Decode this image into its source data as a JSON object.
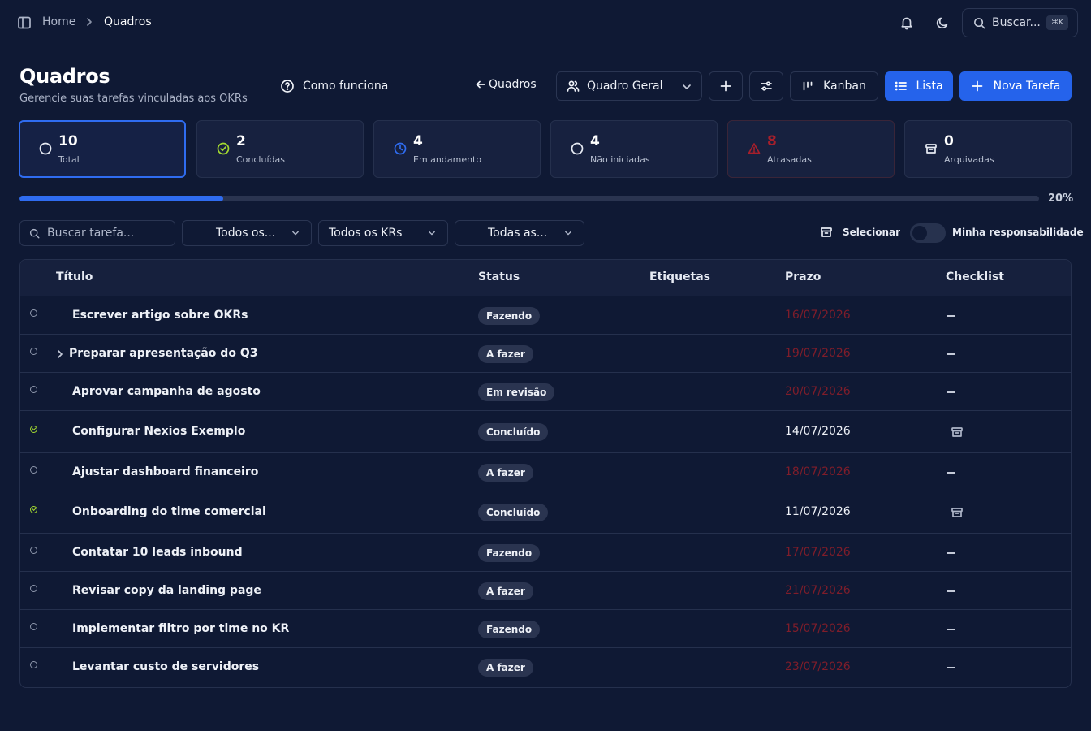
{
  "topbar": {
    "breadcrumb_home": "Home",
    "breadcrumb_current": "Quadros",
    "search_label": "Buscar...",
    "search_shortcut": "⌘K"
  },
  "header": {
    "title": "Quadros",
    "subtitle": "Gerencie suas tarefas vinculadas aos OKRs",
    "how_it_works": "Como funciona",
    "back_label": "Quadros",
    "board_select": "Quadro Geral",
    "kanban_label": "Kanban",
    "list_label": "Lista",
    "new_task_label": "Nova Tarefa"
  },
  "stats": [
    {
      "value": "10",
      "label": "Total",
      "icon": "circle-icon",
      "color": "#e6eaf3"
    },
    {
      "value": "2",
      "label": "Concluídas",
      "icon": "check-circle-icon",
      "color": "#a3d930"
    },
    {
      "value": "4",
      "label": "Em andamento",
      "icon": "clock-icon",
      "color": "#2f6cf0"
    },
    {
      "value": "4",
      "label": "Não iniciadas",
      "icon": "circle-icon",
      "color": "#e6eaf3"
    },
    {
      "value": "8",
      "label": "Atrasadas",
      "icon": "alert-triangle-icon",
      "color": "#a61f2b"
    },
    {
      "value": "0",
      "label": "Arquivadas",
      "icon": "archive-icon",
      "color": "#e6eaf3"
    }
  ],
  "progress": {
    "percent_label": "20%",
    "fraction": 0.2
  },
  "filters": {
    "search_placeholder": "Buscar tarefa...",
    "select1": "Todos os...",
    "select2": "Todos os KRs",
    "select3": "Todas as...",
    "select_label": "Selecionar",
    "my_responsibility": "Minha responsabilidade"
  },
  "table": {
    "columns": [
      "Título",
      "Status",
      "Etiquetas",
      "Prazo",
      "Checklist"
    ],
    "rows": [
      {
        "title": "Escrever artigo sobre OKRs",
        "status": "Fazendo",
        "due": "16/07/2026",
        "late": true,
        "done": false,
        "expandable": false,
        "checklist": "—"
      },
      {
        "title": "Preparar apresentação do Q3",
        "status": "A fazer",
        "due": "19/07/2026",
        "late": true,
        "done": false,
        "expandable": true,
        "checklist": "—"
      },
      {
        "title": "Aprovar campanha de agosto",
        "status": "Em revisão",
        "due": "20/07/2026",
        "late": true,
        "done": false,
        "expandable": false,
        "checklist": "—"
      },
      {
        "title": "Configurar Nexios Exemplo",
        "status": "Concluído",
        "due": "14/07/2026",
        "late": false,
        "done": true,
        "expandable": false,
        "checklist": "archive-icon"
      },
      {
        "title": "Ajustar dashboard financeiro",
        "status": "A fazer",
        "due": "18/07/2026",
        "late": true,
        "done": false,
        "expandable": false,
        "checklist": "—"
      },
      {
        "title": "Onboarding do time comercial",
        "status": "Concluído",
        "due": "11/07/2026",
        "late": false,
        "done": true,
        "expandable": false,
        "checklist": "archive-icon"
      },
      {
        "title": "Contatar 10 leads inbound",
        "status": "Fazendo",
        "due": "17/07/2026",
        "late": true,
        "done": false,
        "expandable": false,
        "checklist": "—"
      },
      {
        "title": "Revisar copy da landing page",
        "status": "A fazer",
        "due": "21/07/2026",
        "late": true,
        "done": false,
        "expandable": false,
        "checklist": "—"
      },
      {
        "title": "Implementar filtro por time no KR",
        "status": "Fazendo",
        "due": "15/07/2026",
        "late": true,
        "done": false,
        "expandable": false,
        "checklist": "—"
      },
      {
        "title": "Levantar custo de servidores",
        "status": "A fazer",
        "due": "23/07/2026",
        "late": true,
        "done": false,
        "expandable": false,
        "checklist": "—"
      }
    ]
  }
}
